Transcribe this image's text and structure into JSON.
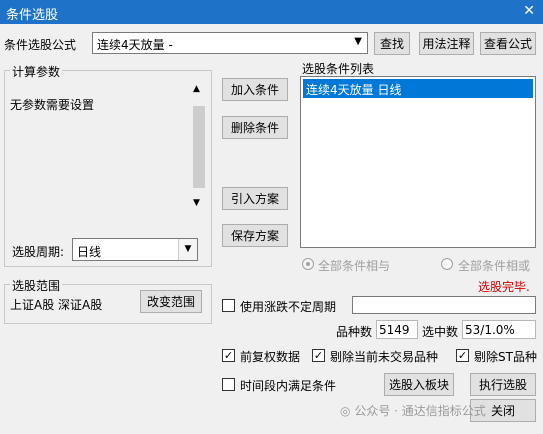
{
  "window": {
    "title": "条件选股",
    "close_glyph": "✕"
  },
  "formula": {
    "label": "条件选股公式",
    "value": "连续4天放量  -",
    "find_button": "查找",
    "usage_button": "用法注释",
    "view_button": "查看公式"
  },
  "params": {
    "group_label": "计算参数",
    "text": "无参数需要设置",
    "period_label": "选股周期:",
    "period_value": "日线"
  },
  "actions": {
    "add": "加入条件",
    "delete": "删除条件",
    "import": "引入方案",
    "save": "保存方案"
  },
  "conditions": {
    "group_label": "选股条件列表",
    "items": [
      "连续4天放量  日线"
    ],
    "radio_and": "全部条件相与",
    "radio_or": "全部条件相或",
    "status": "选股完毕."
  },
  "range": {
    "group_label": "选股范围",
    "value": "上证A股 深证A股",
    "change_button": "改变范围"
  },
  "options": {
    "use_non_fixed_period": "使用涨跌不定周期",
    "variety_count_label": "品种数",
    "variety_count": "5149",
    "selected_label": "选中数",
    "selected_value": "53/1.0%",
    "forward_adjust": "前复权数据",
    "exclude_untraded": "剔除当前未交易品种",
    "exclude_st": "剔除ST品种",
    "time_range": "时间段内满足条件"
  },
  "bottom_buttons": {
    "to_block": "选股入板块",
    "execute": "执行选股",
    "close": "关闭"
  },
  "watermark": "公众号 · 通达信指标公式"
}
